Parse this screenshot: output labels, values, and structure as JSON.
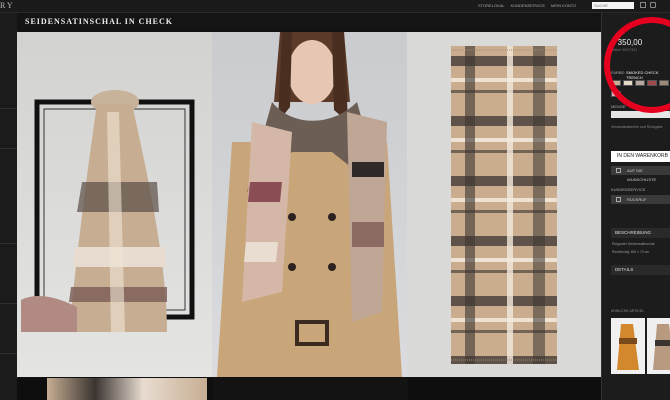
{
  "header": {
    "brand": "RY",
    "links": [
      "STORELOKAL",
      "KUNDENSERVICE",
      "MEIN KONTO"
    ],
    "search_placeholder": "SUCHE"
  },
  "product": {
    "title": "SEIDENSATINSCHAL IN CHECK",
    "price": "€ 350,00",
    "article_no": "Artikel 39107321",
    "color_label": "FARBE:",
    "color_name": "SMOKED CHECK TRENCH",
    "size_label": "MENGE",
    "delivery_text": "Versandkostenfrei und Rückgabe",
    "add_to_cart": "IN DEN WARENKORB",
    "wishlist": "AUF DIE WUNSCHLISTE",
    "service_label": "KUNDENSERVICE",
    "callback": "RÜCKRUF"
  },
  "sections": {
    "description_title": "BESCHREIBUNG",
    "description_lines": [
      "Eleganter Seidensatinschal",
      "Rechteckig 180 x 70 cm"
    ],
    "details_title": "DETAILS",
    "related_title": "ÄHNLICHE ARTIKEL"
  },
  "colors": {
    "accent_red": "#e6001f",
    "sidebar_bg": "#1c1c1c",
    "check_camel": "#c9ad8e",
    "check_black": "#3a3431"
  }
}
